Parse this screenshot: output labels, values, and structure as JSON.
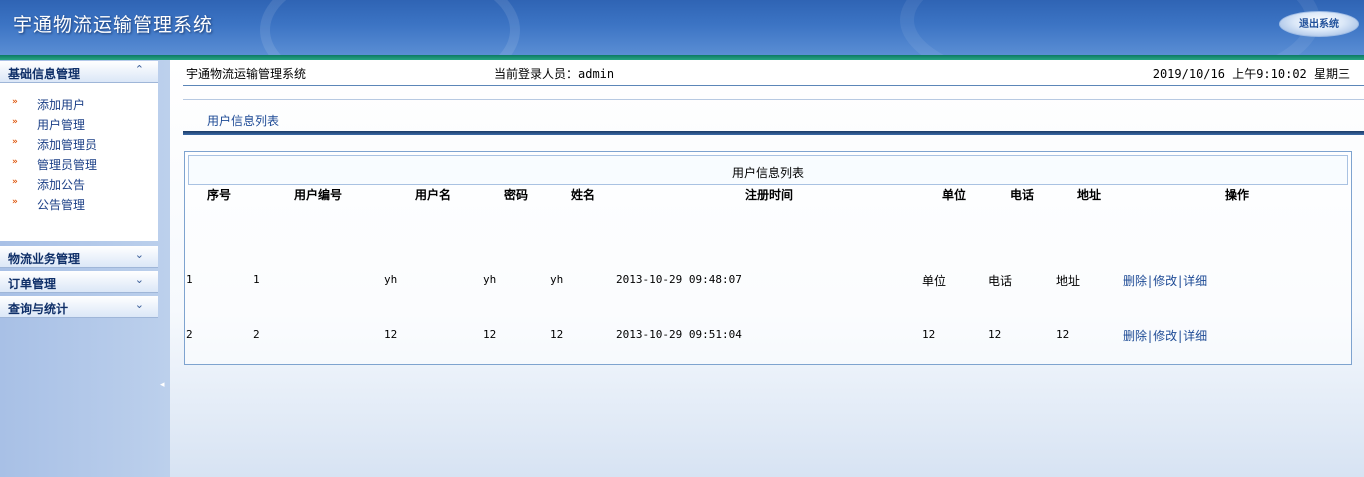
{
  "header": {
    "title": "宇通物流运输管理系统",
    "logout_label": "退出系统"
  },
  "sidebar": {
    "basic": {
      "label": "基础信息管理",
      "items": [
        {
          "label": "添加用户"
        },
        {
          "label": "用户管理"
        },
        {
          "label": "添加管理员"
        },
        {
          "label": "管理员管理"
        },
        {
          "label": "添加公告"
        },
        {
          "label": "公告管理"
        }
      ]
    },
    "logistics": {
      "label": "物流业务管理"
    },
    "orders": {
      "label": "订单管理"
    },
    "stats": {
      "label": "查询与统计"
    }
  },
  "topbar": {
    "system_name": "宇通物流运输管理系统",
    "login_info": "当前登录人员：admin",
    "datetime": "2019/10/16 上午9:10:02 星期三"
  },
  "breadcrumb": "用户信息列表",
  "panel": {
    "title": "用户信息列表"
  },
  "table": {
    "headers": [
      "序号",
      "用户编号",
      "用户名",
      "密码",
      "姓名",
      "注册时间",
      "单位",
      "电话",
      "地址",
      "操作"
    ],
    "rows": [
      {
        "index": "1",
        "user_no": "1",
        "username": "yh",
        "password": "yh",
        "name": "yh",
        "reg_time": "2013-10-29 09:48:07",
        "unit": "单位",
        "phone": "电话",
        "address": "地址"
      },
      {
        "index": "2",
        "user_no": "2",
        "username": "12",
        "password": "12",
        "name": "12",
        "reg_time": "2013-10-29 09:51:04",
        "unit": "12",
        "phone": "12",
        "address": "12"
      }
    ],
    "actions": {
      "delete": "删除",
      "edit": "修改",
      "detail": "详细",
      "separator": "|"
    }
  }
}
